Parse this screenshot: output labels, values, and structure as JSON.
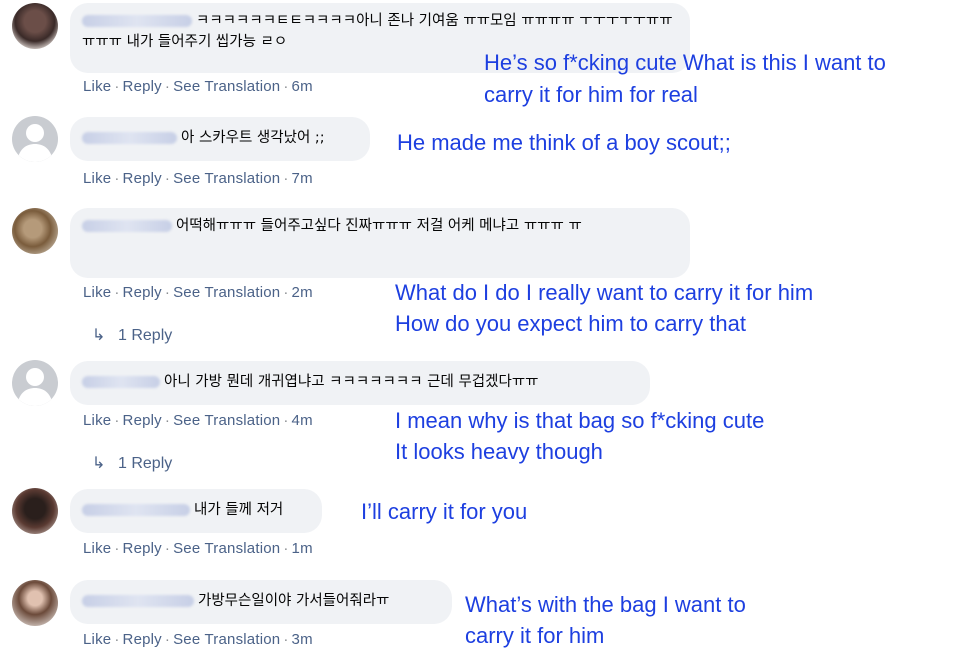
{
  "action_labels": {
    "like": "Like",
    "reply": "Reply",
    "see_translation": "See Translation",
    "separator": "·"
  },
  "comments": [
    {
      "avatar": "profile-photo",
      "text": "ㅋㅋㅋㅋㅋㅋㅌㅌㅋㅋㅋㅋ아니 존나 기여움 ㅠㅠ모임 ㅠㅠㅠㅠ ㅜㅜㅜㅜㅜㅠㅠㅠㅠㅠ 내가 들어주기 씹가능 ㄹㅇ",
      "time": "6m",
      "translation": [
        "He’s so f*cking cute What is this I want to",
        "carry it for him for real"
      ]
    },
    {
      "avatar": "default-avatar",
      "text": "아 스카우트 생각났어 ;;",
      "time": "7m",
      "translation": [
        "He made me think of a boy scout;;"
      ]
    },
    {
      "avatar": "profile-photo",
      "text": "어떡해ㅠㅠㅠ 들어주고싶다 진짜ㅠㅠㅠ 저걸 어케 메냐고 ㅠㅠㅠ ㅠ",
      "time": "2m",
      "replies": "1 Reply",
      "translation": [
        "What do I do I really want to carry it for him",
        "How do you expect him to carry that"
      ]
    },
    {
      "avatar": "default-avatar",
      "text": "아니 가방 뭔데 개귀엽냐고 ㅋㅋㅋㅋㅋㅋㅋ 근데 무겁겠다ㅠㅠ",
      "time": "4m",
      "replies": "1 Reply",
      "translation": [
        "I mean why is that bag so f*cking cute",
        "It looks heavy though"
      ]
    },
    {
      "avatar": "profile-photo",
      "text": "내가 들께 저거",
      "time": "1m",
      "translation": [
        "I’ll carry it for you"
      ]
    },
    {
      "avatar": "profile-photo",
      "text": "가방무슨일이야 가서들어줘라ㅠ",
      "time": "3m",
      "translation": [
        "What’s with the bag I want to",
        "carry it for him"
      ]
    }
  ],
  "colors": {
    "translation": "#1d3fe0",
    "link": "#4b6288",
    "bubble": "#f0f2f5"
  }
}
